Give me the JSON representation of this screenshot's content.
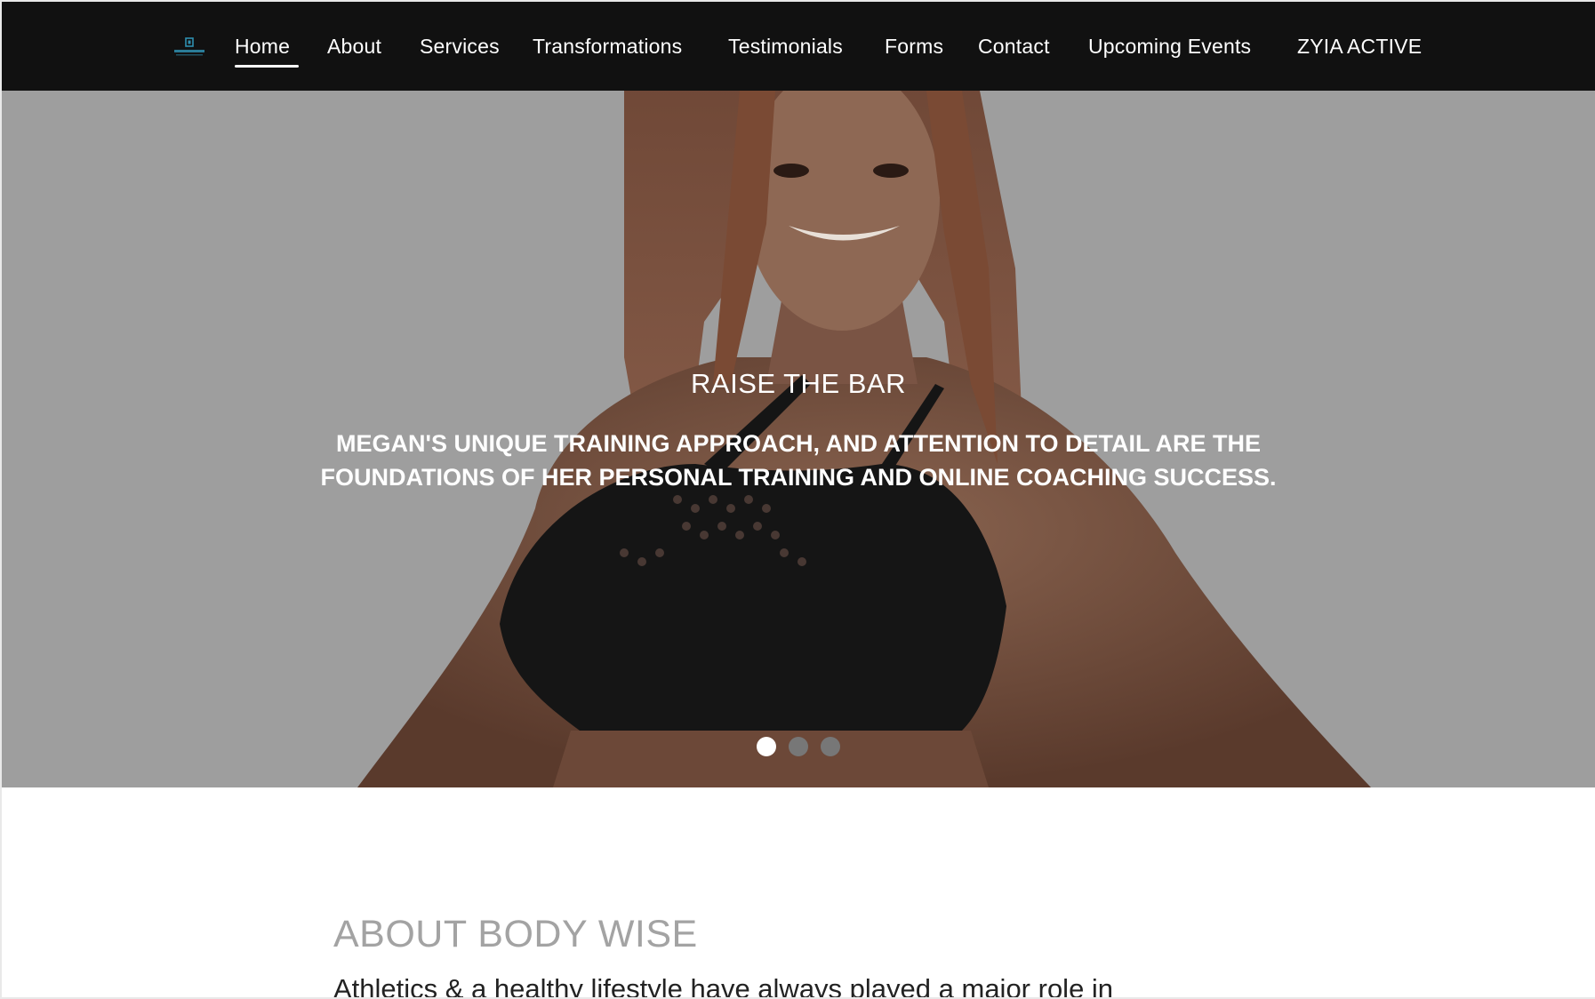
{
  "nav": {
    "logo_icon": "body-wise-logo",
    "items": [
      {
        "label": "Home",
        "active": true
      },
      {
        "label": "About"
      },
      {
        "label": "Services"
      },
      {
        "label": "Transformations"
      },
      {
        "label": "Testimonials"
      },
      {
        "label": "Forms"
      },
      {
        "label": "Contact"
      },
      {
        "label": "Upcoming Events"
      },
      {
        "label": "ZYIA ACTIVE"
      }
    ]
  },
  "hero": {
    "title": "RAISE THE BAR",
    "subtitle_line1": "MEGAN'S UNIQUE TRAINING APPROACH, AND ATTENTION TO DETAIL ARE THE",
    "subtitle_line2": "FOUNDATIONS OF HER PERSONAL TRAINING AND ONLINE COACHING SUCCESS.",
    "slides_total": 3,
    "active_slide": 1
  },
  "about": {
    "title": "ABOUT BODY WISE",
    "intro": "Athletics & a healthy lifestyle have always played a major role in"
  },
  "colors": {
    "nav_bg": "#111111",
    "hero_overlay": "#9c9c9c",
    "text_white": "#ffffff",
    "about_title": "#a3a3a3"
  }
}
